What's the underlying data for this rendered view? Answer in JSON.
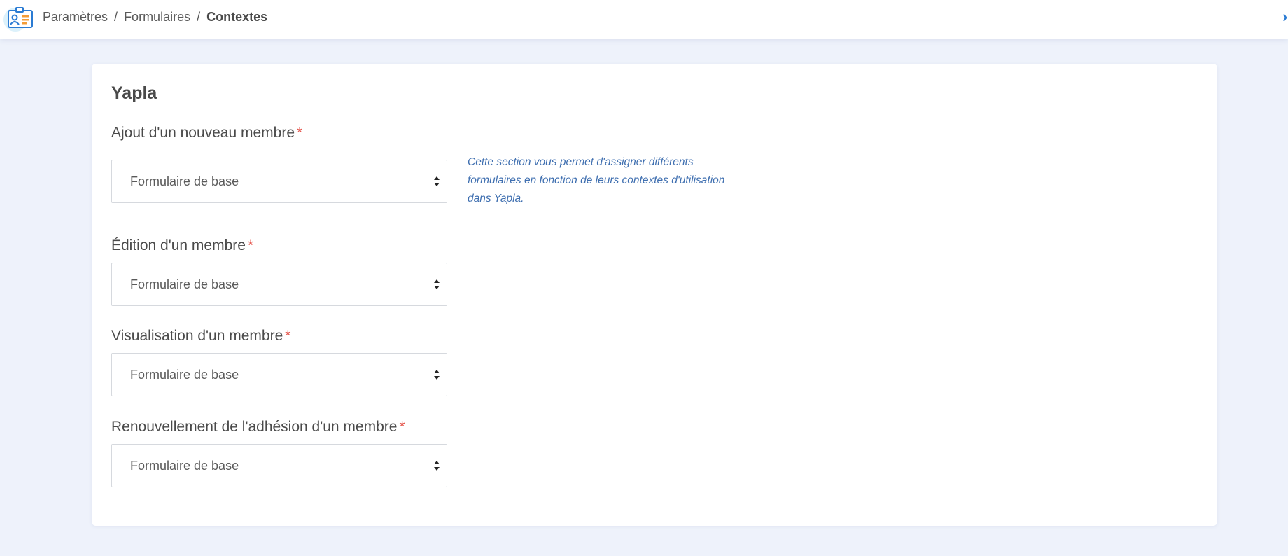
{
  "header": {
    "app_icon": "id-card-icon",
    "breadcrumb": {
      "items": [
        "Paramètres",
        "Formulaires"
      ],
      "separator": "/",
      "current": "Contextes"
    }
  },
  "card": {
    "title": "Yapla",
    "help_text": "Cette section vous permet d'assigner différents formulaires en fonction de leurs contextes d'utilisation dans Yapla.",
    "fields": [
      {
        "label": "Ajout d'un nouveau membre",
        "required_mark": "*",
        "value": "Formulaire de base"
      },
      {
        "label": "Édition d'un membre",
        "required_mark": "*",
        "value": "Formulaire de base"
      },
      {
        "label": "Visualisation d'un membre",
        "required_mark": "*",
        "value": "Formulaire de base"
      },
      {
        "label": "Renouvellement de l'adhésion d'un membre",
        "required_mark": "*",
        "value": "Formulaire de base"
      }
    ]
  },
  "colors": {
    "background": "#eef2fb",
    "required": "#e5584f",
    "help_text": "#3f6fb0",
    "accent": "#2a7bd3"
  }
}
